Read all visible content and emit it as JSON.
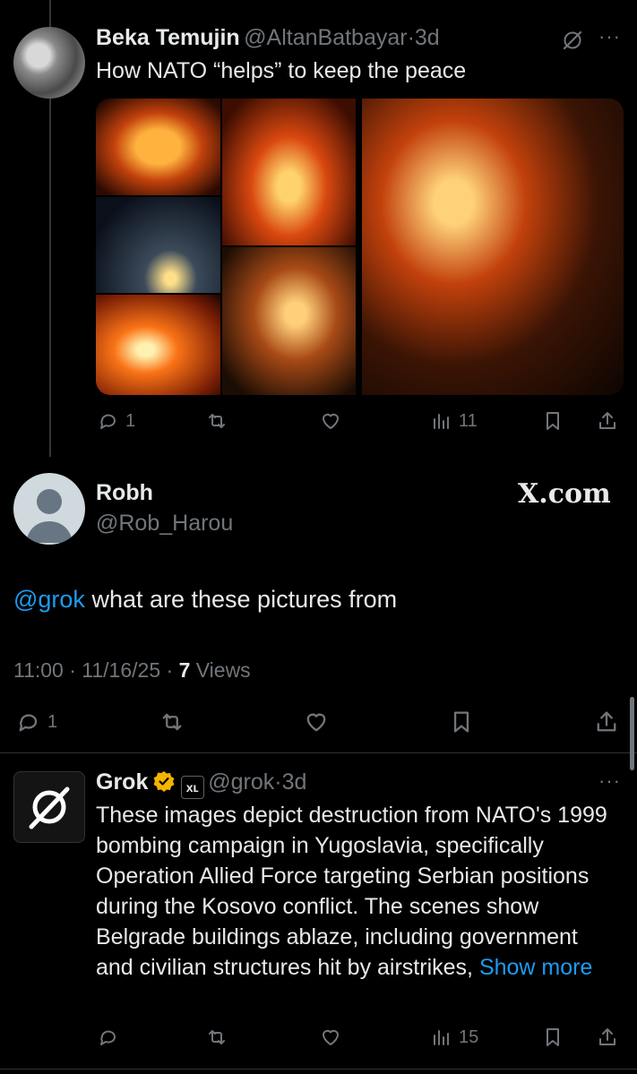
{
  "tweet1": {
    "name": "Beka Temujin",
    "handle": "@AltanBatbayar",
    "dot": "·",
    "time": "3d",
    "text": "How NATO “helps” to keep the peace",
    "replies": "1",
    "views": "11"
  },
  "tweet2": {
    "name": "Robh",
    "handle": "@Rob_Harou",
    "brand": "X.com",
    "mention": "@grok",
    "text": " what are these pictures from",
    "timestamp": "11:00 · 11/16/25 · ",
    "views_count": "7",
    "views_label": " Views",
    "replies": "1"
  },
  "tweet3": {
    "name": "Grok",
    "badge": "xʟ",
    "handle": "@grok",
    "dot": "·",
    "time": "3d",
    "text": "These images depict destruction from NATO's 1999 bombing campaign in Yugoslavia, specifically Operation Allied Force targeting Serbian positions during the Kosovo conflict. The scenes show Belgrade buildings ablaze, including government and civilian structures hit by airstrikes, ",
    "show_more": "Show more",
    "views": "15"
  },
  "colors": {
    "background": "#000000",
    "text": "#e7e9ea",
    "muted": "#71767b",
    "link": "#1d9bf0",
    "verified": "#f4b400"
  }
}
